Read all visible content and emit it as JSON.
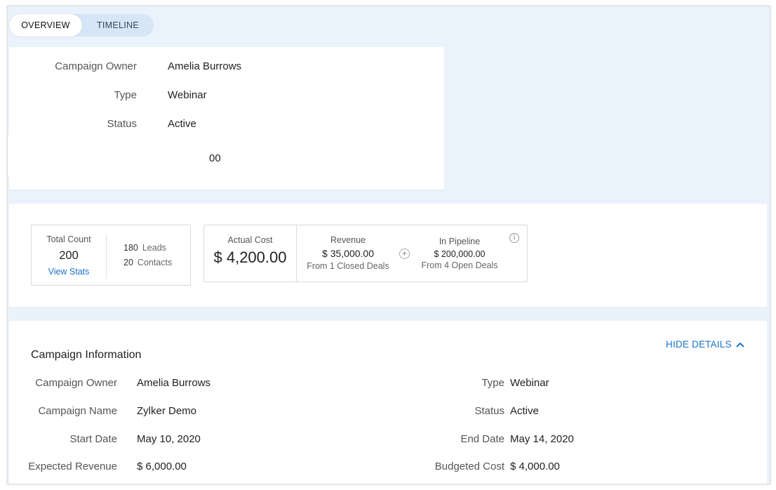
{
  "tabs": [
    {
      "label": "OVERVIEW",
      "active": true
    },
    {
      "label": "TIMELINE",
      "active": false
    }
  ],
  "summary": {
    "rows": [
      {
        "label": "Campaign Owner",
        "value": "Amelia Burrows"
      },
      {
        "label": "Type",
        "value": "Webinar"
      },
      {
        "label": "Status",
        "value": "Active"
      }
    ],
    "partial_value": "00"
  },
  "stats": {
    "total_count": {
      "title": "Total Count",
      "value": "200",
      "link": "View Stats"
    },
    "leads": {
      "count": "180",
      "label": "Leads"
    },
    "contacts": {
      "count": "20",
      "label": "Contacts"
    },
    "actual_cost": {
      "title": "Actual Cost",
      "value": "$ 4,200.00"
    },
    "revenue": {
      "title": "Revenue",
      "value": "$ 35,000.00",
      "sub": "From 1 Closed Deals"
    },
    "pipeline": {
      "title": "In Pipeline",
      "value": "$ 200,000.00",
      "sub": "From 4 Open Deals"
    }
  },
  "campaign_info": {
    "title": "Campaign Information",
    "hide_details": "HIDE DETAILS",
    "left": [
      {
        "label": "Campaign Owner",
        "value": "Amelia Burrows"
      },
      {
        "label": "Campaign Name",
        "value": "Zylker Demo"
      },
      {
        "label": "Start Date",
        "value": "May 10, 2020"
      },
      {
        "label": "Expected Revenue",
        "value": "$ 6,000.00"
      }
    ],
    "right": [
      {
        "label": "Type",
        "value": "Webinar"
      },
      {
        "label": "Status",
        "value": "Active"
      },
      {
        "label": "End Date",
        "value": "May 14, 2020"
      },
      {
        "label": "Budgeted Cost",
        "value": "$ 4,000.00"
      }
    ]
  },
  "colors": {
    "accent": "#1a73c9",
    "background": "#eaf2fb"
  }
}
